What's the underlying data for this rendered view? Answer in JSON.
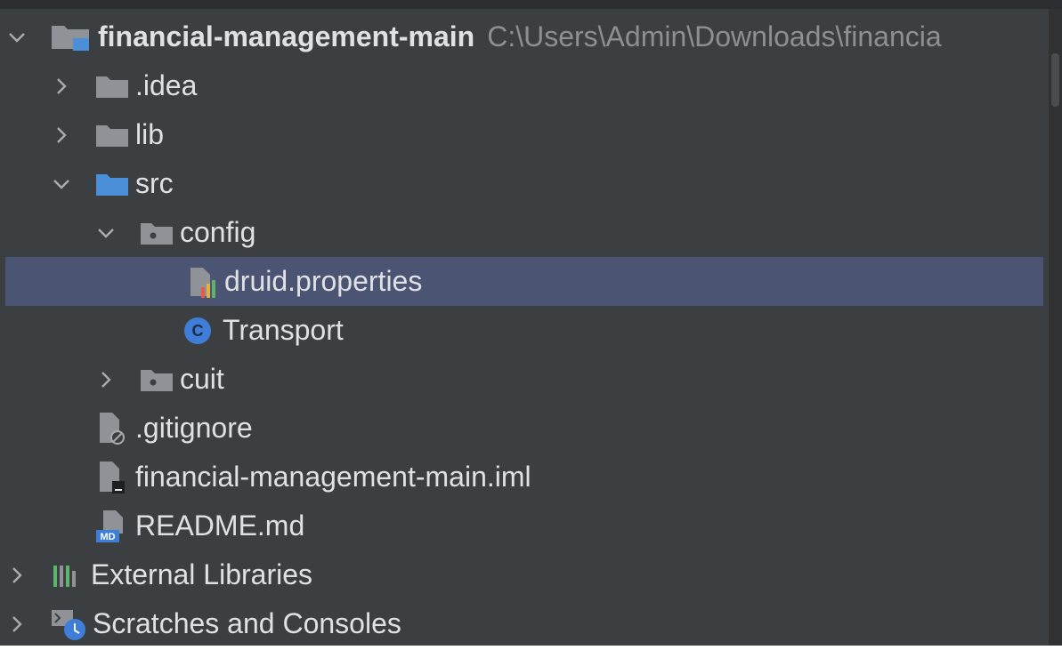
{
  "project_tree": {
    "root": {
      "name": "financial-management-main",
      "path": "C:\\Users\\Admin\\Downloads\\financia"
    },
    "items": [
      {
        "label": ".idea",
        "icon": "folder-icon"
      },
      {
        "label": "lib",
        "icon": "folder-icon"
      },
      {
        "label": "src",
        "icon": "source-folder-icon"
      },
      {
        "label": "config",
        "icon": "package-icon"
      },
      {
        "label": "druid.properties",
        "icon": "properties-file-icon",
        "selected": true
      },
      {
        "label": "Transport",
        "icon": "class-icon"
      },
      {
        "label": "cuit",
        "icon": "package-icon"
      },
      {
        "label": ".gitignore",
        "icon": "ignored-file-icon"
      },
      {
        "label": "financial-management-main.iml",
        "icon": "module-file-icon"
      },
      {
        "label": "README.md",
        "icon": "markdown-file-icon"
      }
    ],
    "external_libraries": "External Libraries",
    "scratches": "Scratches and Consoles",
    "class_badge": "C",
    "md_badge": "MD"
  },
  "colors": {
    "background": "#3c3f41",
    "selection": "#4b5573",
    "text": "#dfe1e5",
    "path_text": "#8c8f94",
    "folder": "#8f9398",
    "source_folder": "#4a8fd8"
  }
}
